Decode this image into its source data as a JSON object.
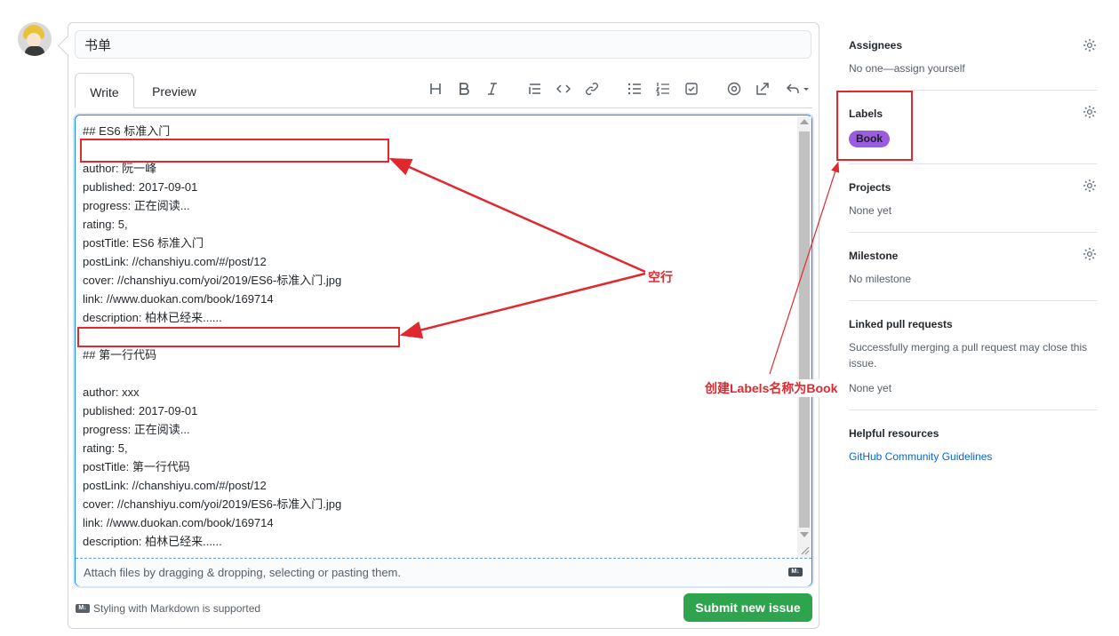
{
  "issue": {
    "title_value": "书单",
    "tabs": {
      "write": "Write",
      "preview": "Preview"
    },
    "body_lines": [
      "## ES6 标准入门",
      "",
      "author: 阮一峰",
      "published: 2017-09-01",
      "progress: 正在阅读...",
      "rating: 5,",
      "postTitle: ES6 标准入门",
      "postLink: //chanshiyu.com/#/post/12",
      "cover: //chanshiyu.com/yoi/2019/ES6-标准入门.jpg",
      "link: //www.duokan.com/book/169714",
      "description: 柏林已经来......",
      "",
      "## 第一行代码",
      "",
      "author: xxx",
      "published: 2017-09-01",
      "progress: 正在阅读...",
      "rating: 5,",
      "postTitle: 第一行代码",
      "postLink: //chanshiyu.com/#/post/12",
      "cover: //chanshiyu.com/yoi/2019/ES6-标准入门.jpg",
      "link: //www.duokan.com/book/169714",
      "description: 柏林已经来......"
    ],
    "attach_text": "Attach files by dragging & dropping, selecting or pasting them.",
    "markdown_note": "Styling with Markdown is supported",
    "submit_label": "Submit new issue",
    "md_badge": "M↓"
  },
  "toolbar_icons": [
    "heading-icon",
    "bold-icon",
    "italic-icon",
    "quote-icon",
    "code-icon",
    "link-icon",
    "bulleted-list-icon",
    "numbered-list-icon",
    "task-list-icon",
    "mention-icon",
    "reference-icon",
    "reply-icon"
  ],
  "sidebar": {
    "assignees": {
      "heading": "Assignees",
      "value": "No one—assign yourself"
    },
    "labels": {
      "heading": "Labels",
      "badge": "Book",
      "badge_color": "#9c5ce0"
    },
    "projects": {
      "heading": "Projects",
      "value": "None yet"
    },
    "milestone": {
      "heading": "Milestone",
      "value": "No milestone"
    },
    "linked": {
      "heading": "Linked pull requests",
      "line1": "Successfully merging a pull request may close this",
      "line2": "issue.",
      "value": "None yet"
    },
    "helpful": {
      "heading": "Helpful resources",
      "link": "GitHub Community Guidelines"
    }
  },
  "annotations": {
    "blank_line": "空行",
    "create_labels": "创建Labels名称为Book",
    "color": "#e0282e"
  }
}
